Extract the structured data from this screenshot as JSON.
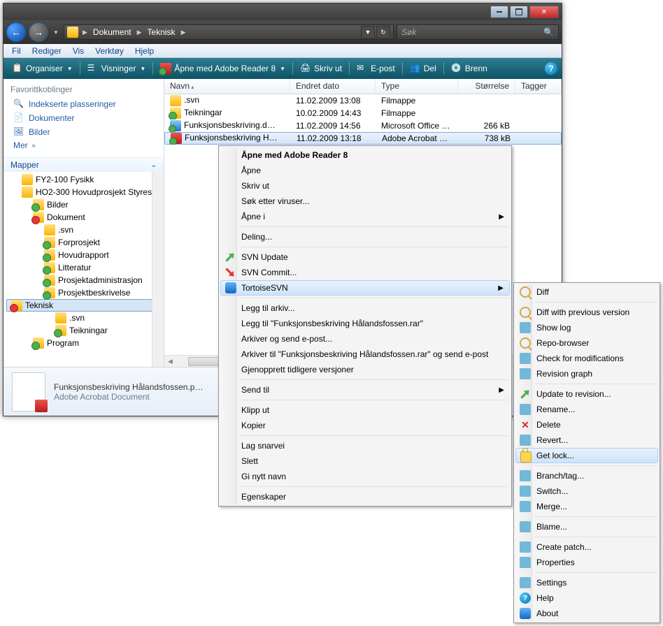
{
  "titlebar": {
    "min": "_",
    "max": "□",
    "close": "✕"
  },
  "nav": {
    "crumbs": [
      "Dokument",
      "Teknisk"
    ],
    "search_placeholder": "Søk"
  },
  "menubar": [
    "Fil",
    "Rediger",
    "Vis",
    "Verktøy",
    "Hjelp"
  ],
  "toolbar": {
    "organize": "Organiser",
    "views": "Visninger",
    "open_with": "Åpne med Adobe Reader 8",
    "print": "Skriv ut",
    "email": "E-post",
    "share": "Del",
    "burn": "Brenn"
  },
  "favorites": {
    "header": "Favorittkoblinger",
    "items": [
      "Indekserte plasseringer",
      "Dokumenter",
      "Bilder"
    ],
    "more": "Mer"
  },
  "folders_header": "Mapper",
  "tree": [
    {
      "indent": 1,
      "icon": "ico-folder",
      "label": "FY2-100 Fysikk"
    },
    {
      "indent": 1,
      "icon": "ico-folder",
      "label": "HO2-300 Hovudprosjekt Styres…"
    },
    {
      "indent": 2,
      "icon": "ico-folder-svn",
      "label": "Bilder"
    },
    {
      "indent": 2,
      "icon": "ico-folder-mod",
      "label": "Dokument"
    },
    {
      "indent": 3,
      "icon": "ico-folder",
      "label": ".svn"
    },
    {
      "indent": 3,
      "icon": "ico-folder-svn",
      "label": "Forprosjekt"
    },
    {
      "indent": 3,
      "icon": "ico-folder-svn",
      "label": "Hovudrapport"
    },
    {
      "indent": 3,
      "icon": "ico-folder-svn",
      "label": "Litteratur"
    },
    {
      "indent": 3,
      "icon": "ico-folder-svn",
      "label": "Prosjektadministrasjon"
    },
    {
      "indent": 3,
      "icon": "ico-folder-svn",
      "label": "Prosjektbeskrivelse"
    },
    {
      "indent": 3,
      "icon": "ico-folder-mod",
      "label": "Teknisk",
      "selected": true
    },
    {
      "indent": 4,
      "icon": "ico-folder",
      "label": ".svn"
    },
    {
      "indent": 4,
      "icon": "ico-folder-svn",
      "label": "Teikningar"
    },
    {
      "indent": 2,
      "icon": "ico-folder-svn",
      "label": "Program"
    }
  ],
  "columns": {
    "name": "Navn",
    "date": "Endret dato",
    "type": "Type",
    "size": "Størrelse",
    "tags": "Tagger"
  },
  "files": [
    {
      "icon": "ico-folder",
      "name": ".svn",
      "date": "11.02.2009 13:08",
      "type": "Filmappe",
      "size": ""
    },
    {
      "icon": "ico-folder-svn",
      "name": "Teikningar",
      "date": "10.02.2009 14:43",
      "type": "Filmappe",
      "size": ""
    },
    {
      "icon": "ico-doc",
      "name": "Funksjonsbeskriving.d…",
      "date": "11.02.2009 14:56",
      "type": "Microsoft Office …",
      "size": "266 kB"
    },
    {
      "icon": "ico-pdf",
      "name": "Funksjonsbeskriving H…",
      "date": "11.02.2009 13:18",
      "type": "Adobe Acrobat D…",
      "size": "738 kB",
      "selected": true
    }
  ],
  "details": {
    "name": "Funksjonsbeskriving Hålandsfossen.p…",
    "type": "Adobe Acrobat Document"
  },
  "context_menu": [
    {
      "label": "Åpne med Adobe Reader 8",
      "bold": true
    },
    {
      "label": "Åpne"
    },
    {
      "label": "Skriv ut"
    },
    {
      "label": "Søk etter viruser..."
    },
    {
      "label": "Åpne i",
      "submenu": true
    },
    {
      "sep": true
    },
    {
      "label": "Deling..."
    },
    {
      "sep": true
    },
    {
      "label": "SVN Update",
      "icon": "ico-green-arrow"
    },
    {
      "label": "SVN Commit...",
      "icon": "ico-red-arrow"
    },
    {
      "label": "TortoiseSVN",
      "icon": "ico-svn",
      "submenu": true,
      "highlight": true
    },
    {
      "sep": true
    },
    {
      "label": "Legg til arkiv..."
    },
    {
      "label": "Legg til \"Funksjonsbeskriving Hålandsfossen.rar\""
    },
    {
      "label": "Arkiver og send e-post..."
    },
    {
      "label": "Arkiver til \"Funksjonsbeskriving Hålandsfossen.rar\" og send e-post"
    },
    {
      "label": "Gjenopprett tidligere versjoner"
    },
    {
      "sep": true
    },
    {
      "label": "Send til",
      "submenu": true
    },
    {
      "sep": true
    },
    {
      "label": "Klipp ut"
    },
    {
      "label": "Kopier"
    },
    {
      "sep": true
    },
    {
      "label": "Lag snarvei"
    },
    {
      "label": "Slett"
    },
    {
      "label": "Gi nytt navn"
    },
    {
      "sep": true
    },
    {
      "label": "Egenskaper"
    }
  ],
  "submenu": [
    {
      "label": "Diff",
      "icon": "ico-mag"
    },
    {
      "sep": true
    },
    {
      "label": "Diff with previous version",
      "icon": "ico-mag"
    },
    {
      "label": "Show log",
      "icon": "ico-generic"
    },
    {
      "label": "Repo-browser",
      "icon": "ico-mag"
    },
    {
      "label": "Check for modifications",
      "icon": "ico-generic"
    },
    {
      "label": "Revision graph",
      "icon": "ico-generic"
    },
    {
      "sep": true
    },
    {
      "label": "Update to revision...",
      "icon": "ico-green-arrow"
    },
    {
      "label": "Rename...",
      "icon": "ico-generic"
    },
    {
      "label": "Delete",
      "icon": "ico-x"
    },
    {
      "label": "Revert...",
      "icon": "ico-generic"
    },
    {
      "label": "Get lock...",
      "icon": "ico-lock",
      "highlight": true
    },
    {
      "sep": true
    },
    {
      "label": "Branch/tag...",
      "icon": "ico-generic"
    },
    {
      "label": "Switch...",
      "icon": "ico-generic"
    },
    {
      "label": "Merge...",
      "icon": "ico-generic"
    },
    {
      "sep": true
    },
    {
      "label": "Blame...",
      "icon": "ico-generic"
    },
    {
      "sep": true
    },
    {
      "label": "Create patch...",
      "icon": "ico-generic"
    },
    {
      "label": "Properties",
      "icon": "ico-generic"
    },
    {
      "sep": true
    },
    {
      "label": "Settings",
      "icon": "ico-generic"
    },
    {
      "label": "Help",
      "icon": "ico-help-q"
    },
    {
      "label": "About",
      "icon": "ico-svn"
    }
  ]
}
